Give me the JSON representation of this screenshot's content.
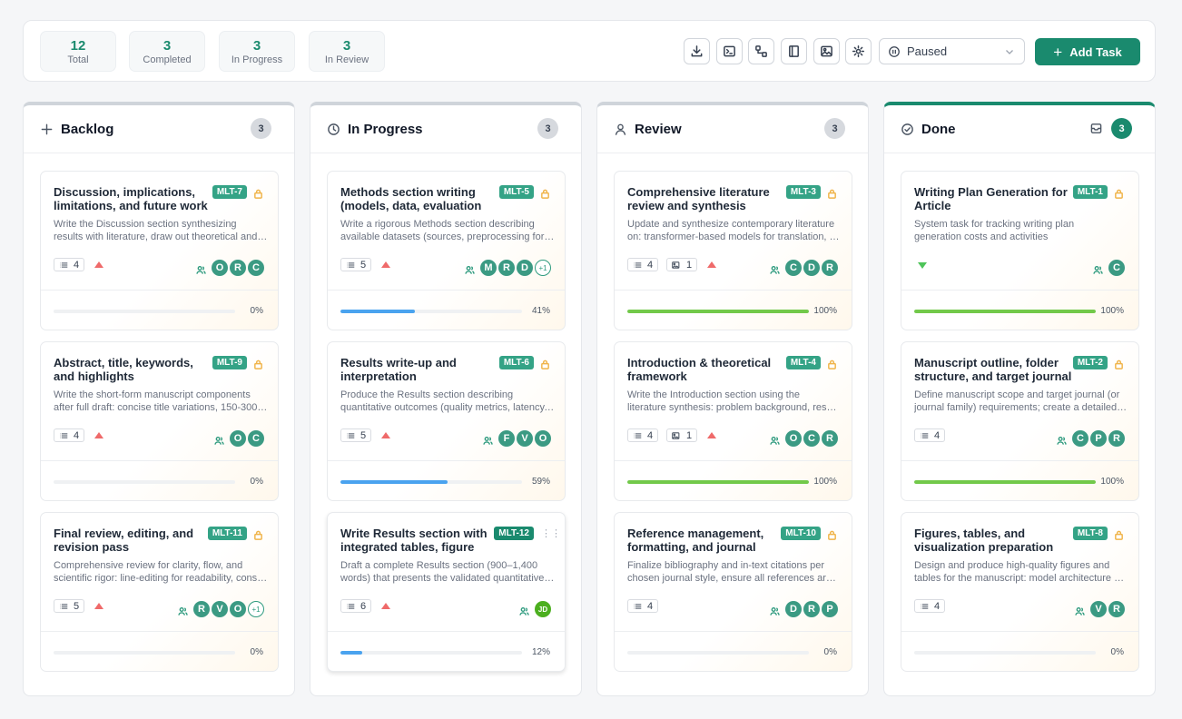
{
  "stats": [
    {
      "value": "12",
      "label": "Total"
    },
    {
      "value": "3",
      "label": "Completed"
    },
    {
      "value": "3",
      "label": "In Progress"
    },
    {
      "value": "3",
      "label": "In Review"
    }
  ],
  "toolbar": {
    "icons": [
      "download-icon",
      "terminal-icon",
      "workflow-icon",
      "book-icon",
      "image-icon",
      "gear-icon"
    ],
    "status_select": "Paused",
    "add_task_label": "Add Task"
  },
  "colors": {
    "accent": "#1a8a6e",
    "progress_blue": "#4aa3ef",
    "progress_green": "#72c94a",
    "priority_high": "#ef6a6a",
    "priority_low": "#4ec45a"
  },
  "columns": [
    {
      "title": "Backlog",
      "icon": "plus-icon",
      "count": "3",
      "cards": [
        {
          "id": "MLT-7",
          "title": "Discussion, implications, limitations, and future work",
          "desc": [
            "Write the Discussion section synthesizing",
            "results with literature, draw out theoretical and practical implications"
          ],
          "chips": [
            {
              "icon": "list-icon",
              "value": "4"
            }
          ],
          "priority": "up",
          "assignees": [
            "O",
            "R",
            "C"
          ],
          "more": "",
          "progress": 0,
          "pct": "0%"
        },
        {
          "id": "MLT-9",
          "title": "Abstract, title, keywords, and highlights",
          "desc": [
            "Write the short-form manuscript components",
            "after full draft: concise title variations, 150-300 word abstract"
          ],
          "chips": [
            {
              "icon": "list-icon",
              "value": "4"
            }
          ],
          "priority": "up",
          "assignees": [
            "O",
            "C"
          ],
          "more": "",
          "progress": 0,
          "pct": "0%"
        },
        {
          "id": "MLT-11",
          "title": "Final review, editing, and revision pass",
          "desc": [
            "Comprehensive review for clarity, flow, and",
            "scientific rigor: line-editing for readability, consistency"
          ],
          "chips": [
            {
              "icon": "list-icon",
              "value": "5"
            }
          ],
          "priority": "up",
          "assignees": [
            "R",
            "V",
            "O"
          ],
          "more": "+1",
          "progress": 0,
          "pct": "0%"
        }
      ]
    },
    {
      "title": "In Progress",
      "icon": "clock-icon",
      "count": "3",
      "cards": [
        {
          "id": "MLT-5",
          "title": "Methods section writing (models, data, evaluation protocol)",
          "desc": [
            "Write a rigorous Methods section describing",
            "available datasets (sources, preprocessing for training)"
          ],
          "chips": [
            {
              "icon": "list-icon",
              "value": "5"
            }
          ],
          "priority": "up",
          "assignees": [
            "M",
            "R",
            "D"
          ],
          "more": "+1",
          "progress": 41,
          "pct": "41%"
        },
        {
          "id": "MLT-6",
          "title": "Results write-up and interpretation",
          "desc": [
            "Produce the Results section describing",
            "quantitative outcomes (quality metrics, latency, cost)"
          ],
          "chips": [
            {
              "icon": "list-icon",
              "value": "5"
            }
          ],
          "priority": "up",
          "assignees": [
            "F",
            "V",
            "O"
          ],
          "more": "",
          "progress": 59,
          "pct": "59%"
        },
        {
          "id": "MLT-12",
          "title": "Write Results section with integrated tables, figure references",
          "desc": [
            "Draft a complete Results section (900–1,400",
            "words) that presents the validated quantitative findings"
          ],
          "chips": [
            {
              "icon": "list-icon",
              "value": "6"
            }
          ],
          "priority": "up",
          "assignees": [
            "JD"
          ],
          "more": "",
          "progress": 12,
          "pct": "12%",
          "active": true
        }
      ]
    },
    {
      "title": "Review",
      "icon": "user-icon",
      "count": "3",
      "cards": [
        {
          "id": "MLT-3",
          "title": "Comprehensive literature review and synthesis",
          "desc": [
            "Update and synthesize contemporary literature",
            "on: transformer-based models for translation, evaluation"
          ],
          "chips": [
            {
              "icon": "list-icon",
              "value": "4"
            },
            {
              "icon": "image-icon",
              "value": "1"
            }
          ],
          "priority": "up",
          "assignees": [
            "C",
            "D",
            "R"
          ],
          "more": "",
          "progress": 100,
          "pct": "100%"
        },
        {
          "id": "MLT-4",
          "title": "Introduction & theoretical framework",
          "desc": [
            "Write the Introduction section using the",
            "literature synthesis: problem background, research gap"
          ],
          "chips": [
            {
              "icon": "list-icon",
              "value": "4"
            },
            {
              "icon": "image-icon",
              "value": "1"
            }
          ],
          "priority": "up",
          "assignees": [
            "O",
            "C",
            "R"
          ],
          "more": "",
          "progress": 100,
          "pct": "100%"
        },
        {
          "id": "MLT-10",
          "title": "Reference management, formatting, and journal compliance",
          "desc": [
            "Finalize bibliography and in-text citations per",
            "chosen journal style, ensure all references are verified"
          ],
          "chips": [
            {
              "icon": "list-icon",
              "value": "4"
            }
          ],
          "priority": "",
          "assignees": [
            "D",
            "R",
            "P"
          ],
          "more": "",
          "progress": 0,
          "pct": "0%"
        }
      ]
    },
    {
      "title": "Done",
      "icon": "check-circle-icon",
      "count": "3",
      "cards": [
        {
          "id": "MLT-1",
          "title": "Writing Plan Generation for Article",
          "desc": [
            "System task for tracking writing plan",
            "generation costs and activities"
          ],
          "chips": [],
          "priority": "down",
          "assignees": [
            "C"
          ],
          "more": "",
          "progress": 100,
          "pct": "100%"
        },
        {
          "id": "MLT-2",
          "title": "Manuscript outline, folder structure, and target journal selection",
          "desc": [
            "Define manuscript scope and target journal (or",
            "journal family) requirements; create a detailed outline"
          ],
          "chips": [
            {
              "icon": "list-icon",
              "value": "4"
            }
          ],
          "priority": "",
          "assignees": [
            "C",
            "P",
            "R"
          ],
          "more": "",
          "progress": 100,
          "pct": "100%"
        },
        {
          "id": "MLT-8",
          "title": "Figures, tables, and visualization preparation",
          "desc": [
            "Design and produce high-quality figures and",
            "tables for the manuscript: model architecture diagrams"
          ],
          "chips": [
            {
              "icon": "list-icon",
              "value": "4"
            }
          ],
          "priority": "",
          "assignees": [
            "V",
            "R"
          ],
          "more": "",
          "progress": 0,
          "pct": "0%"
        }
      ]
    }
  ]
}
